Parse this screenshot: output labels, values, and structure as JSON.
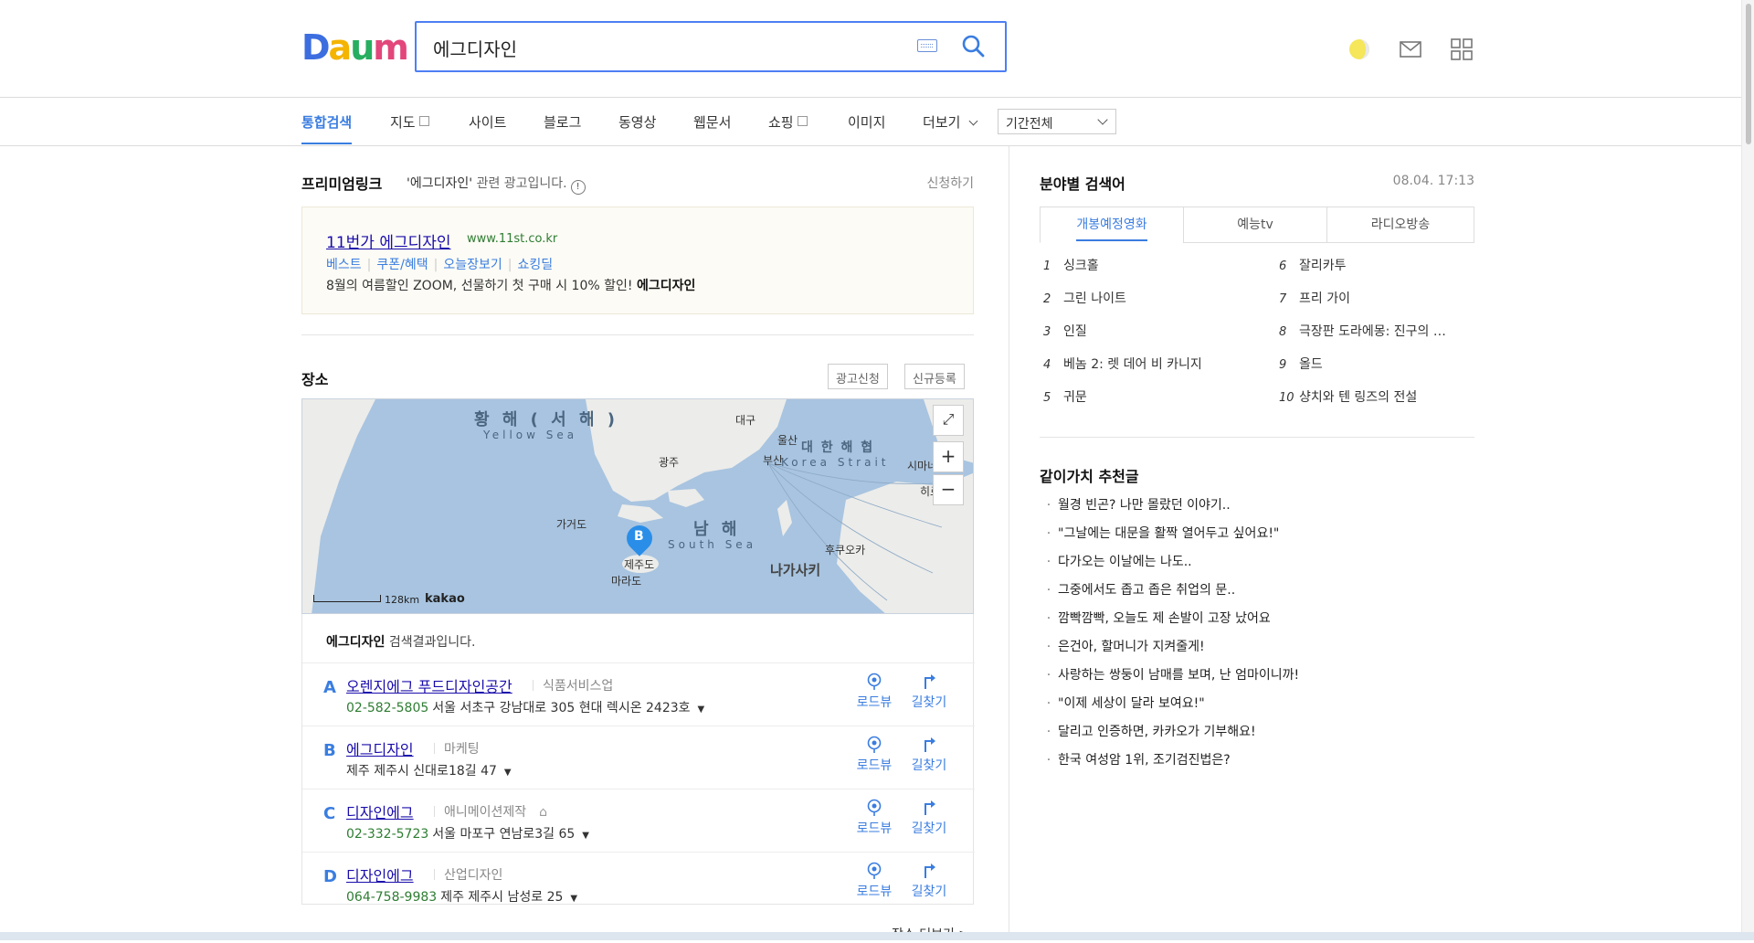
{
  "header": {
    "logo": [
      "D",
      "a",
      "u",
      "m"
    ],
    "search_value": "에그디자인"
  },
  "nav": {
    "tabs": [
      "통합검색",
      "지도",
      "사이트",
      "블로그",
      "동영상",
      "웹문서",
      "쇼핑",
      "이미지",
      "더보기"
    ],
    "period": "기간전체"
  },
  "premium": {
    "title": "프리미엄링크",
    "query": "'에그디자인'",
    "suffix": "관련 광고입니다.",
    "info": "!",
    "apply": "신청하기",
    "ad": {
      "title": "11번가 에그디자인",
      "url": "www.11st.co.kr",
      "links": [
        "베스트",
        "쿠폰/혜택",
        "오늘장보기",
        "쇼킹딜"
      ],
      "desc_prefix": "8월의 여름할인 ZOOM, 선물하기 첫 구매 시 10% 할인!",
      "desc_bold": "에그디자인"
    }
  },
  "place": {
    "title": "장소",
    "buttons": [
      "광고신청",
      "신규등록"
    ],
    "map": {
      "sea_labels": [
        "황 해 ( 서 해 )",
        "Yellow Sea",
        "남 해",
        "South Sea",
        "대 한 해 협",
        "Korea Strait"
      ],
      "city_labels": [
        "대구",
        "울산",
        "광주",
        "부산",
        "가거도",
        "제주도",
        "마라도",
        "후쿠오카",
        "나가사키",
        "시마네",
        "히로"
      ],
      "pin_letter": "B",
      "scale": "128km",
      "brand": "kakao",
      "zoom_in": "+",
      "zoom_out": "−"
    },
    "caption_bold": "에그디자인",
    "caption_rest": " 검색결과입니다.",
    "roadview_label": "로드뷰",
    "directions_label": "길찾기",
    "results": [
      {
        "letter": "A",
        "name": "오렌지에그 푸드디자인공간",
        "category": "식품서비스업",
        "tel": "02-582-5805",
        "address": "서울 서초구 강남대로 305 현대 렉시온 2423호"
      },
      {
        "letter": "B",
        "name": "에그디자인",
        "category": "마케팅",
        "tel": "",
        "address": "제주 제주시 신대로18길 47"
      },
      {
        "letter": "C",
        "name": "디자인에그",
        "category": "애니메이션제작",
        "tel": "02-332-5723",
        "address": "서울 마포구 연남로3길 65"
      },
      {
        "letter": "D",
        "name": "디자인에그",
        "category": "산업디자인",
        "tel": "064-758-9983",
        "address": "제주 제주시 남성로 25"
      }
    ],
    "more": "장소 더보기 >"
  },
  "trends": {
    "title": "분야별 검색어",
    "time": "08.04. 17:13",
    "tabs": [
      "개봉예정영화",
      "예능tv",
      "라디오방송"
    ],
    "items": [
      {
        "rank": "1",
        "text": "싱크홀"
      },
      {
        "rank": "2",
        "text": "그린 나이트"
      },
      {
        "rank": "3",
        "text": "인질"
      },
      {
        "rank": "4",
        "text": "베놈 2: 렛 데어 비 카니지"
      },
      {
        "rank": "5",
        "text": "귀문"
      },
      {
        "rank": "6",
        "text": "잘리카투"
      },
      {
        "rank": "7",
        "text": "프리 가이"
      },
      {
        "rank": "8",
        "text": "극장판 도라에몽: 진구의 …"
      },
      {
        "rank": "9",
        "text": "올드"
      },
      {
        "rank": "10",
        "text": "샹치와 텐 링즈의 전설"
      }
    ]
  },
  "recommend": {
    "title": "같이가치 추천글",
    "items": [
      "월경 빈곤? 나만 몰랐던 이야기..",
      "\"그날에는 대문을 활짝 열어두고 싶어요!\"",
      "다가오는 이날에는 나도..",
      "그중에서도 좁고 좁은 취업의 문..",
      "깜빡깜빡, 오늘도 제 손발이 고장 났어요",
      "은건아, 할머니가 지켜줄게!",
      "사랑하는 쌍둥이 남매를 보며, 난 엄마이니까!",
      "\"이제 세상이 달라 보여요!\"",
      "달리고 인증하면, 카카오가 기부해요!",
      "한국 여성암 1위, 조기검진법은?"
    ]
  }
}
